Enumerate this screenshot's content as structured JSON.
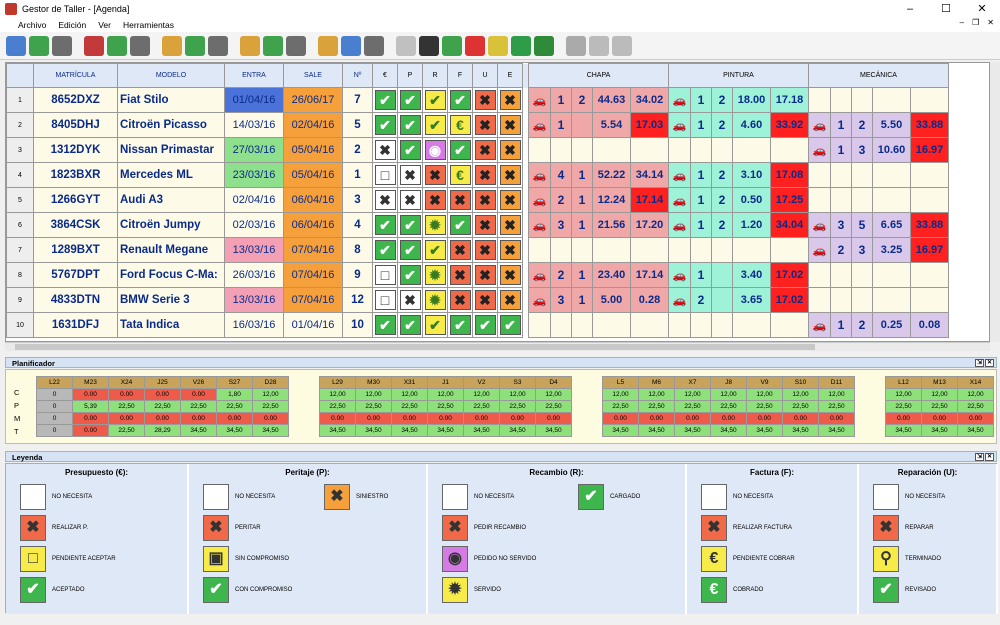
{
  "window": {
    "title": "Gestor de Taller - [Agenda]"
  },
  "menu": [
    "Archivo",
    "Edición",
    "Ver",
    "Herramientas"
  ],
  "colors": {
    "blue": "#4a72d8",
    "gray": "#c4c4c4",
    "green": "#8fe08c",
    "orange": "#f5a03a",
    "pink": "#f4a0b4",
    "white": "#fdfbe8",
    "st_green": "#3fb64d",
    "st_red": "#f06a4a",
    "st_yellow": "#f7eb4a",
    "st_purple": "#d57be4",
    "st_white": "#ffffff",
    "chapa": "#f0a7a7",
    "pintura": "#9ef2d8",
    "mecanica": "#d9c8ea",
    "alert": "#ff2020"
  },
  "table": {
    "headers": {
      "mat": "MATRÍCULA",
      "mod": "MODELO",
      "entra": "ENTRA",
      "sale": "SALE",
      "n": "Nº",
      "e1": "€",
      "p": "P",
      "r": "R",
      "f": "F",
      "u": "U",
      "e2": "E"
    },
    "sections": {
      "chapa": "CHAPA",
      "pintura": "PINTURA",
      "mecanica": "MECÁNICA"
    },
    "rows": [
      {
        "num": "1",
        "mat": "8652DXZ",
        "mod": "Fiat Stilo",
        "entra": "01/04/16",
        "entraC": "blue",
        "sale": "26/06/17",
        "saleC": "orange",
        "n": "7",
        "st": [
          "✔|st_green",
          "✔|st_green",
          "✔|st_yellow",
          "✔|st_green",
          "✖|st_red",
          "✖|st_orange"
        ],
        "chapa": [
          "1",
          "2",
          "44.63",
          "34.02",
          ""
        ],
        "pintura": [
          "1",
          "2",
          "18.00",
          "17.18",
          ""
        ],
        "mec": [
          "",
          "",
          "",
          ""
        ]
      },
      {
        "num": "2",
        "mat": "8405DHJ",
        "mod": "Citroën Picasso",
        "entra": "14/03/16",
        "entraC": "white",
        "sale": "02/04/16",
        "saleC": "orange",
        "n": "5",
        "st": [
          "✔|st_green",
          "✔|st_green",
          "✔|st_yellow",
          "€|st_yellow",
          "✖|st_red",
          "✖|st_orange"
        ],
        "chapa": [
          "1",
          "",
          "5.54",
          "17.03",
          "alert"
        ],
        "pintura": [
          "1",
          "2",
          "4.60",
          "33.92",
          "alert"
        ],
        "mec": [
          "1",
          "2",
          "5.50",
          "33.88",
          "alert"
        ]
      },
      {
        "num": "3",
        "mat": "1312DYK",
        "mod": "Nissan Primastar",
        "entra": "27/03/16",
        "entraC": "green",
        "sale": "05/04/16",
        "saleC": "orange",
        "n": "2",
        "st": [
          "✖|st_white",
          "✔|st_green",
          "◉|st_purple",
          "✔|st_green",
          "✖|st_red",
          "✖|st_orange"
        ],
        "chapa": [
          "",
          "",
          "",
          "",
          ""
        ],
        "pintura": [
          "",
          "",
          "",
          "",
          ""
        ],
        "mec": [
          "1",
          "3",
          "10.60",
          "16.97",
          "alert"
        ]
      },
      {
        "num": "4",
        "mat": "1823BXR",
        "mod": "Mercedes ML",
        "entra": "23/03/16",
        "entraC": "green",
        "sale": "05/04/16",
        "saleC": "orange",
        "n": "1",
        "st": [
          "□|st_white",
          "✖|st_white",
          "✖|st_red",
          "€|st_yellow",
          "✖|st_red",
          "✖|st_orange"
        ],
        "chapa": [
          "4",
          "1",
          "52.22",
          "34.14",
          ""
        ],
        "pintura": [
          "1",
          "2",
          "3.10",
          "17.08",
          "alert"
        ],
        "mec": [
          "",
          "",
          "",
          ""
        ]
      },
      {
        "num": "5",
        "mat": "1266GYT",
        "mod": "Audi A3",
        "entra": "02/04/16",
        "entraC": "white",
        "sale": "06/04/16",
        "saleC": "orange",
        "n": "3",
        "st": [
          "✖|st_white",
          "✖|st_white",
          "✖|st_red",
          "✖|st_red",
          "✖|st_red",
          "✖|st_orange"
        ],
        "chapa": [
          "2",
          "1",
          "12.24",
          "17.14",
          "alert"
        ],
        "pintura": [
          "1",
          "2",
          "0.50",
          "17.25",
          "alert"
        ],
        "mec": [
          "",
          "",
          "",
          ""
        ]
      },
      {
        "num": "6",
        "mat": "3864CSK",
        "mod": "Citroën Jumpy",
        "entra": "02/03/16",
        "entraC": "white",
        "sale": "06/04/16",
        "saleC": "orange",
        "n": "4",
        "st": [
          "✔|st_green",
          "✔|st_green",
          "✹|st_yellow",
          "✔|st_green",
          "✖|st_red",
          "✖|st_orange"
        ],
        "chapa": [
          "3",
          "1",
          "21.56",
          "17.20",
          ""
        ],
        "pintura": [
          "1",
          "2",
          "1.20",
          "34.04",
          "alert"
        ],
        "mec": [
          "3",
          "5",
          "6.65",
          "33.88",
          "alert"
        ]
      },
      {
        "num": "7",
        "mat": "1289BXT",
        "mod": "Renault Megane",
        "entra": "13/03/16",
        "entraC": "pink",
        "sale": "07/04/16",
        "saleC": "orange",
        "n": "8",
        "st": [
          "✔|st_green",
          "✔|st_green",
          "✔|st_yellow",
          "✖|st_red",
          "✖|st_red",
          "✖|st_orange"
        ],
        "chapa": [
          "",
          "",
          "",
          "",
          ""
        ],
        "pintura": [
          "",
          "",
          "",
          "",
          ""
        ],
        "mec": [
          "2",
          "3",
          "3.25",
          "16.97",
          "alert"
        ]
      },
      {
        "num": "8",
        "mat": "5767DPT",
        "mod": "Ford Focus C-Ma:",
        "entra": "26/03/16",
        "entraC": "white",
        "sale": "07/04/16",
        "saleC": "orange",
        "n": "9",
        "st": [
          "□|st_white",
          "✔|st_green",
          "✹|st_yellow",
          "✖|st_red",
          "✖|st_red",
          "✖|st_orange"
        ],
        "chapa": [
          "2",
          "1",
          "23.40",
          "17.14",
          ""
        ],
        "pintura": [
          "1",
          "",
          "3.40",
          "17.02",
          "alert"
        ],
        "mec": [
          "",
          "",
          "",
          ""
        ]
      },
      {
        "num": "9",
        "mat": "4833DTN",
        "mod": "BMW Serie 3",
        "entra": "13/03/16",
        "entraC": "pink",
        "sale": "07/04/16",
        "saleC": "orange",
        "n": "12",
        "st": [
          "□|st_white",
          "✖|st_white",
          "✹|st_yellow",
          "✖|st_red",
          "✖|st_red",
          "✖|st_orange"
        ],
        "chapa": [
          "3",
          "1",
          "5.00",
          "0.28",
          ""
        ],
        "pintura": [
          "2",
          "",
          "3.65",
          "17.02",
          "alert"
        ],
        "mec": [
          "",
          "",
          "",
          ""
        ]
      },
      {
        "num": "10",
        "mat": "1631DFJ",
        "mod": "Tata Indica",
        "entra": "16/03/16",
        "entraC": "white",
        "sale": "01/04/16",
        "saleC": "white",
        "n": "10",
        "st": [
          "✔|st_green",
          "✔|st_green",
          "✔|st_yellow",
          "✔|st_green",
          "✔|st_green",
          "✔|st_green"
        ],
        "chapa": [
          "",
          "",
          "",
          "",
          ""
        ],
        "pintura": [
          "",
          "",
          "",
          "",
          ""
        ],
        "mec": [
          "1",
          "2",
          "0.25",
          "0.08",
          ""
        ]
      }
    ]
  },
  "planner": {
    "title": "Planificador",
    "row_labels": [
      "C",
      "P",
      "M",
      "T"
    ],
    "weeks": [
      {
        "days": [
          "L22",
          "M23",
          "X24",
          "J25",
          "V26",
          "S27",
          "D28"
        ],
        "rows": [
          [
            "0",
            "0.00",
            "0.00",
            "0.00",
            "0.00",
            "1,80",
            "12,00"
          ],
          [
            "0",
            "5,39",
            "22,50",
            "22,50",
            "22,50",
            "22,50",
            "22,50"
          ],
          [
            "0",
            "0.00",
            "0.00",
            "0.00",
            "0.00",
            "0.00",
            "0.00"
          ],
          [
            "0",
            "0.00",
            "22,50",
            "28,29",
            "34,50",
            "34,50",
            "34,50"
          ]
        ]
      },
      {
        "days": [
          "L29",
          "M30",
          "X31",
          "J1",
          "V2",
          "S3",
          "D4"
        ],
        "rows": [
          [
            "12,00",
            "12,00",
            "12,00",
            "12,00",
            "12,00",
            "12,00",
            "12,00"
          ],
          [
            "22,50",
            "22,50",
            "22,50",
            "22,50",
            "22,50",
            "22,50",
            "22,50"
          ],
          [
            "0.00",
            "0.00",
            "0.00",
            "0.00",
            "0.00",
            "0.00",
            "0.00"
          ],
          [
            "34,50",
            "34,50",
            "34,50",
            "34,50",
            "34,50",
            "34,50",
            "34,50"
          ]
        ]
      },
      {
        "days": [
          "L5",
          "M6",
          "X7",
          "J8",
          "V9",
          "S10",
          "D11"
        ],
        "rows": [
          [
            "12,00",
            "12,00",
            "12,00",
            "12,00",
            "12,00",
            "12,00",
            "12,00"
          ],
          [
            "22,50",
            "22,50",
            "22,50",
            "22,50",
            "22,50",
            "22,50",
            "22,50"
          ],
          [
            "0.00",
            "0.00",
            "0.00",
            "0.00",
            "0.00",
            "0.00",
            "0.00"
          ],
          [
            "34,50",
            "34,50",
            "34,50",
            "34,50",
            "34,50",
            "34,50",
            "34,50"
          ]
        ]
      },
      {
        "days": [
          "L12",
          "M13",
          "X14"
        ],
        "rows": [
          [
            "12,00",
            "12,00",
            "12,00"
          ],
          [
            "22,50",
            "22,50",
            "22,50"
          ],
          [
            "0.00",
            "0.00",
            "0.00"
          ],
          [
            "34,50",
            "34,50",
            "34,50"
          ]
        ]
      }
    ]
  },
  "legend": {
    "title": "Leyenda",
    "columns": [
      {
        "title": "Presupuesto (€):",
        "items": [
          [
            "",
            "st_white",
            "NO NECESITA"
          ],
          [
            "✖",
            "st_red",
            "REALIZAR P."
          ],
          [
            "□",
            "st_yellow",
            "PENDIENTE ACEPTAR"
          ],
          [
            "✔",
            "st_green",
            "ACEPTADO"
          ]
        ]
      },
      {
        "title": "Peritaje (P):",
        "items": [
          [
            "",
            "st_white",
            "NO NECESITA"
          ],
          [
            "✖",
            "st_red",
            "PERITAR"
          ],
          [
            "▣",
            "st_yellow",
            "SIN COMPROMISO"
          ],
          [
            "✔",
            "st_green",
            "CON COMPROMISO"
          ],
          [
            "✖",
            "st_orange",
            "SINIESTRO"
          ]
        ]
      },
      {
        "title": "Recambio (R):",
        "items": [
          [
            "",
            "st_white",
            "NO NECESITA"
          ],
          [
            "✖",
            "st_red",
            "PEDIR RECAMBIO"
          ],
          [
            "◉",
            "st_purple",
            "PEDIDO NO SERVIDO"
          ],
          [
            "✹",
            "st_yellow",
            "SERVIDO"
          ],
          [
            "✔",
            "st_green",
            "CARGADO"
          ]
        ]
      },
      {
        "title": "Factura (F):",
        "items": [
          [
            "",
            "st_white",
            "NO NECESITA"
          ],
          [
            "✖",
            "st_red",
            "REALIZAR FACTURA"
          ],
          [
            "€",
            "st_yellow",
            "PENDIENTE COBRAR"
          ],
          [
            "€",
            "st_green",
            "COBRADO"
          ]
        ]
      },
      {
        "title": "Reparación (U):",
        "items": [
          [
            "",
            "st_white",
            "NO NECESITA"
          ],
          [
            "✖",
            "st_red",
            "REPARAR"
          ],
          [
            "⚲",
            "st_yellow",
            "TERMINADO"
          ],
          [
            "✔",
            "st_green",
            "REVISADO"
          ]
        ]
      }
    ]
  }
}
